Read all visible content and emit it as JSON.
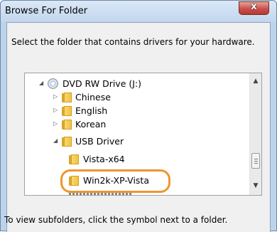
{
  "dialog": {
    "title": "Browse For Folder",
    "close_label": "x",
    "prompt": "Select the folder that contains drivers for your hardware.",
    "hint": "To view subfolders, click the symbol next to a folder."
  },
  "tree": {
    "drive": {
      "label": "DVD RW Drive (J:)",
      "expanded": true
    },
    "folders": [
      {
        "label": "Chinese",
        "expanded": false
      },
      {
        "label": "English",
        "expanded": false
      },
      {
        "label": "Korean",
        "expanded": false
      },
      {
        "label": "USB Driver",
        "expanded": true
      }
    ],
    "subfolders": [
      {
        "label": "Vista-x64"
      },
      {
        "label": "Win2k-XP-Vista",
        "highlighted": true
      }
    ]
  },
  "colors": {
    "highlight": "#ee9630",
    "folder": "#f2c343"
  },
  "icons": {
    "drive": "dvd-drive-icon",
    "folder": "folder-icon",
    "expand": "collapsed-triangle-icon",
    "collapse": "expanded-triangle-icon"
  }
}
